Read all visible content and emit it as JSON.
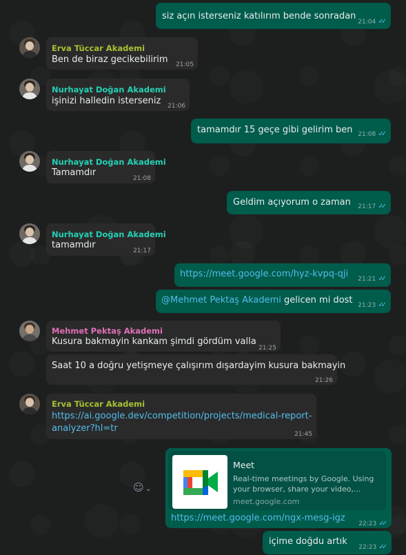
{
  "messages": [
    {
      "text": "siz açın isterseniz katılırım bende sonradan",
      "time": "21:04"
    },
    {
      "sender": "Erva Tüccar Akademi",
      "text": "Ben de biraz gecikebilirim",
      "time": "21:05"
    },
    {
      "sender": "Nurhayat Doğan Akademi",
      "text": "işinizi halledin isterseniz",
      "time": "21:06"
    },
    {
      "text": "tamamdır 15 geçe gibi gelirim ben",
      "time": "21:08"
    },
    {
      "sender": "Nurhayat Doğan Akademi",
      "text": "Tamamdır",
      "time": "21:08"
    },
    {
      "text": "Geldim açıyorum o zaman",
      "time": "21:17"
    },
    {
      "sender": "Nurhayat Doğan Akademi",
      "text": "tamamdır",
      "time": "21:17"
    },
    {
      "text": "https://meet.google.com/hyz-kvpq-qji",
      "time": "21:21"
    },
    {
      "mention": "@Mehmet Pektaş Akademi",
      "text": " gelicen mi dost",
      "time": "21:23"
    },
    {
      "sender": "Mehmet Pektaş Akademi",
      "text": "Kusura bakmayin kankam şimdi gördüm valla",
      "time": "21:25"
    },
    {
      "text": "Saat 10 a doğru yetişmeye çalışırım dışardayim kusura bakmayin",
      "time": "21:26"
    },
    {
      "sender": "Erva Tüccar Akademi",
      "text_line1": "https://ai.google.dev/competition/projects/medical-report-",
      "text_line2": "analyzer?hl=tr",
      "time": "21:45"
    },
    {
      "preview_title": "Meet",
      "preview_desc_line1": "Real-time meetings by Google. Using",
      "preview_desc_line2": "your browser, share your video,...",
      "preview_domain": "meet.google.com",
      "text": "https://meet.google.com/ngx-mesg-igz",
      "time": "22:23"
    },
    {
      "text": "içime doğdu artık",
      "time": "22:23"
    }
  ],
  "ticks": "✓✓",
  "emoji_icon": "☺",
  "chevron": "⌄",
  "colors": {
    "outgoing": "#005c4b",
    "incoming": "#2a2a2a",
    "erva": "#a5c232",
    "nurhayat": "#25d0b4",
    "mehmet": "#e06fb6",
    "link": "#53bdeb"
  }
}
